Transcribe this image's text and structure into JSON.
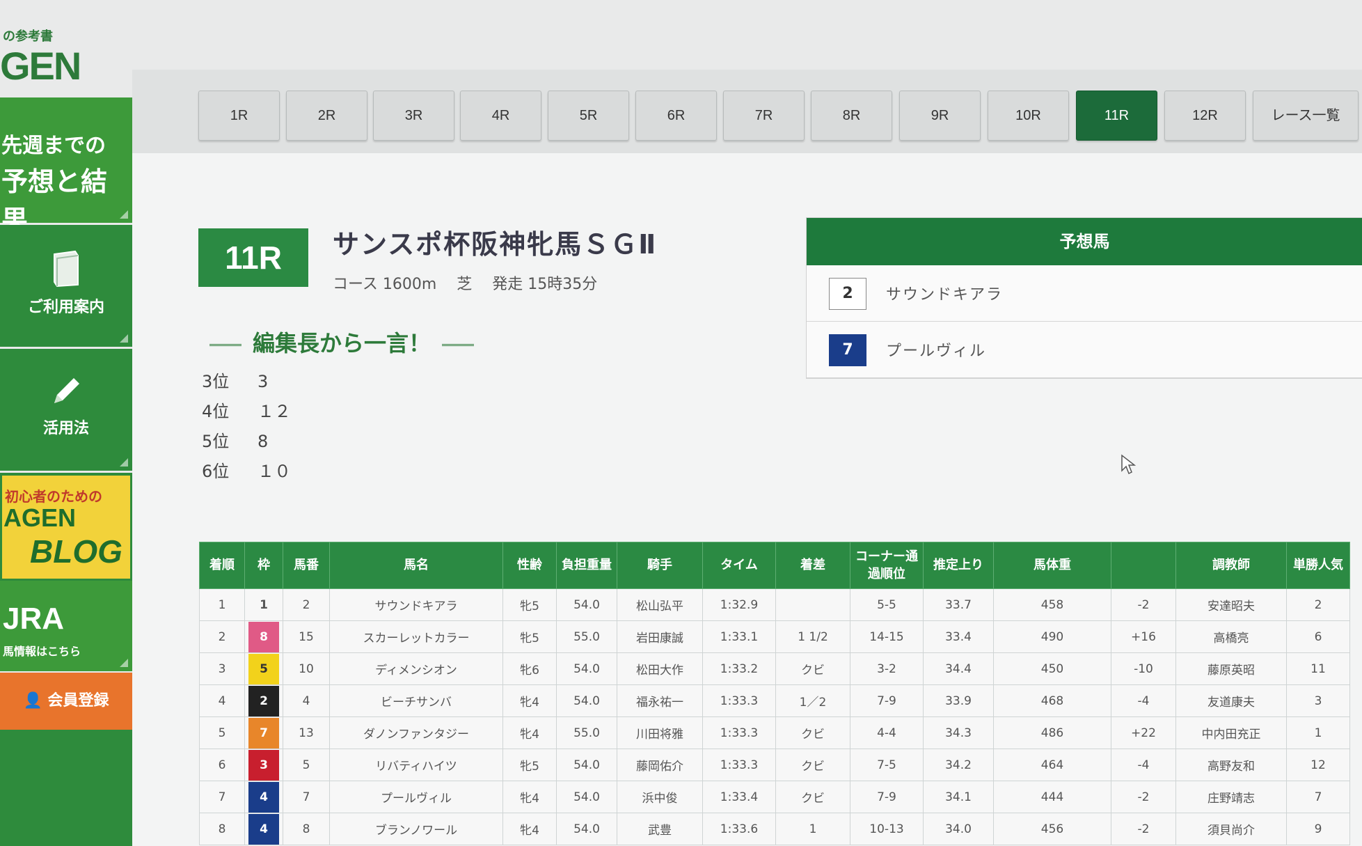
{
  "logo": {
    "tagline": "の参考書",
    "wordmark": "GEN"
  },
  "sidebar": {
    "results": {
      "line1": "先週までの",
      "line2": "予想と結果"
    },
    "guide": {
      "label": "ご利用案内",
      "icon": "book-icon"
    },
    "usage": {
      "label": "活用法",
      "icon": "pencil-icon"
    },
    "blog": {
      "line1": "初心者のための",
      "line2": "AGEN",
      "line3": "BLOG"
    },
    "jra": {
      "title": "JRA",
      "sub": "馬情報はこちら"
    },
    "member": {
      "label": "会員登録",
      "icon": "user-icon"
    }
  },
  "race_tabs": [
    "1R",
    "2R",
    "3R",
    "4R",
    "5R",
    "6R",
    "7R",
    "8R",
    "9R",
    "10R",
    "11R",
    "12R",
    "レース一覧"
  ],
  "active_tab": "11R",
  "race": {
    "badge": "11R",
    "title": "サンスポ杯阪神牝馬ＳＧⅡ",
    "info": "コース 1600m　 芝　 発走 15時35分"
  },
  "editor": {
    "heading": "編集長から一言！",
    "items": [
      {
        "pos": "3位",
        "val": "3"
      },
      {
        "pos": "4位",
        "val": "１２"
      },
      {
        "pos": "5位",
        "val": "8"
      },
      {
        "pos": "6位",
        "val": "１０"
      }
    ]
  },
  "prediction": {
    "heading": "予想馬",
    "horses": [
      {
        "num": "2",
        "name": "サウンドキアラ",
        "color": "#ffffff"
      },
      {
        "num": "7",
        "name": "プールヴィル",
        "color": "#1a3d8a"
      }
    ]
  },
  "results": {
    "headers": [
      "着順",
      "枠",
      "馬番",
      "馬名",
      "性齢",
      "負担重量",
      "騎手",
      "タイム",
      "着差",
      "コーナー通過順位",
      "推定上り",
      "馬体重",
      "",
      "調教師",
      "単勝人気"
    ],
    "rows": [
      [
        "1",
        "1",
        "2",
        "サウンドキアラ",
        "牝5",
        "54.0",
        "松山弘平",
        "1:32.9",
        "",
        "5-5",
        "33.7",
        "458",
        "-2",
        "安達昭夫",
        "2"
      ],
      [
        "2",
        "8",
        "15",
        "スカーレットカラー",
        "牝5",
        "55.0",
        "岩田康誠",
        "1:33.1",
        "1 1/2",
        "14-15",
        "33.4",
        "490",
        "+16",
        "高橋亮",
        "6"
      ],
      [
        "3",
        "5",
        "10",
        "ディメンシオン",
        "牝6",
        "54.0",
        "松田大作",
        "1:33.2",
        "クビ",
        "3-2",
        "34.4",
        "450",
        "-10",
        "藤原英昭",
        "11"
      ],
      [
        "4",
        "2",
        "4",
        "ビーチサンバ",
        "牝4",
        "54.0",
        "福永祐一",
        "1:33.3",
        "1／2",
        "7-9",
        "33.9",
        "468",
        "-4",
        "友道康夫",
        "3"
      ],
      [
        "5",
        "7",
        "13",
        "ダノンファンタジー",
        "牝4",
        "55.0",
        "川田将雅",
        "1:33.3",
        "クビ",
        "4-4",
        "34.3",
        "486",
        "+22",
        "中内田充正",
        "1"
      ],
      [
        "6",
        "3",
        "5",
        "リバティハイツ",
        "牝5",
        "54.0",
        "藤岡佑介",
        "1:33.3",
        "クビ",
        "7-5",
        "34.2",
        "464",
        "-4",
        "高野友和",
        "12"
      ],
      [
        "7",
        "4",
        "7",
        "プールヴィル",
        "牝4",
        "54.0",
        "浜中俊",
        "1:33.4",
        "クビ",
        "7-9",
        "34.1",
        "444",
        "-2",
        "庄野靖志",
        "7"
      ],
      [
        "8",
        "4",
        "8",
        "ブランノワール",
        "牝4",
        "54.0",
        "武豊",
        "1:33.6",
        "1",
        "10-13",
        "34.0",
        "456",
        "-2",
        "須貝尚介",
        "9"
      ]
    ],
    "frame_colors": {
      "1": "#ffffff",
      "2": "#222222",
      "3": "#c81f2e",
      "4": "#1a3d8a",
      "5": "#f2d21b",
      "6": "#2e8b3c",
      "7": "#e8862a",
      "8": "#e05a86"
    }
  }
}
